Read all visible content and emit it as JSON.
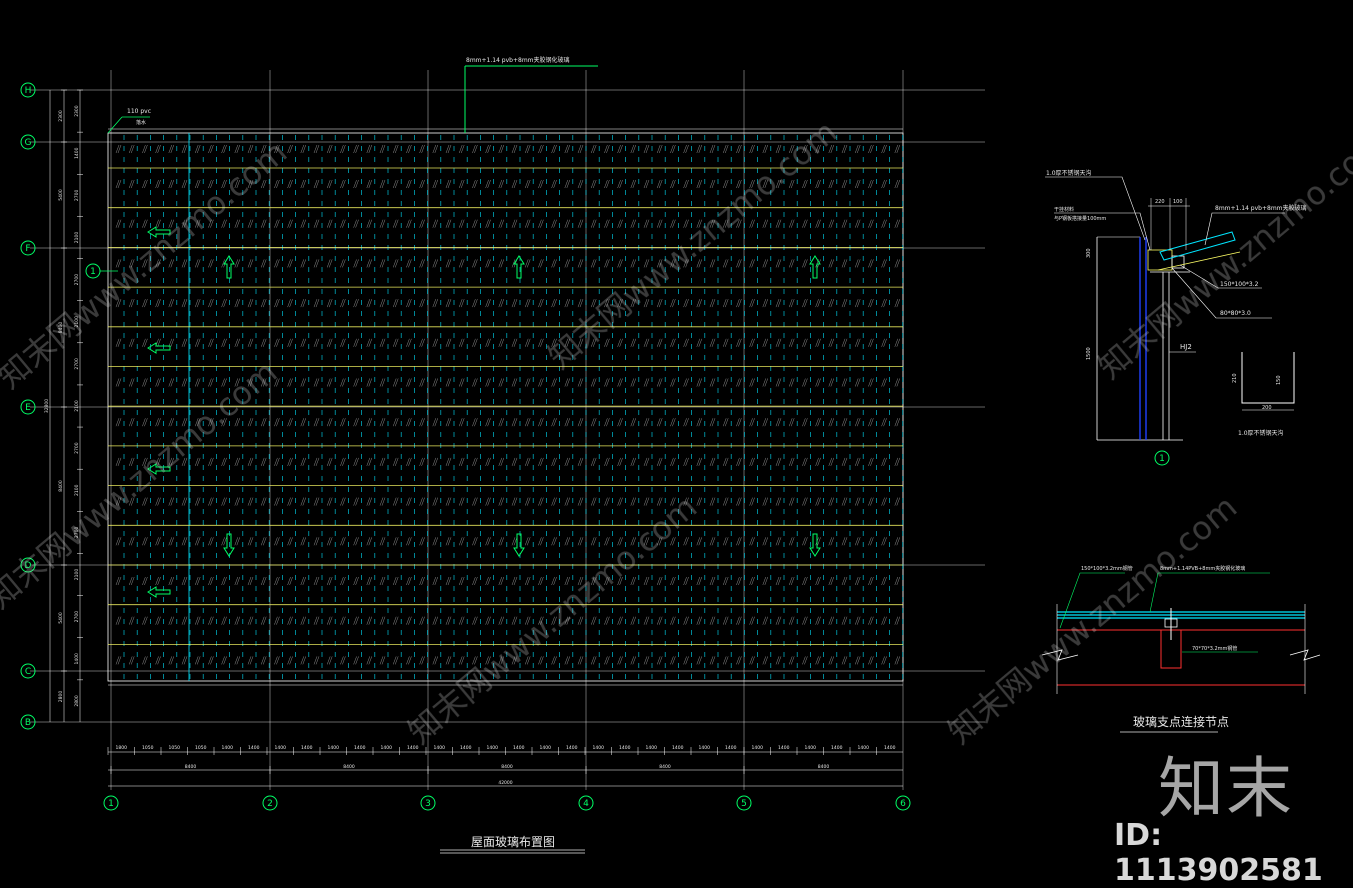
{
  "plan": {
    "title": "屋面玻璃布置图",
    "top_callout": "8mm+1.14 pvb+8mm夹胶钢化玻璃",
    "pvc_note": "110 pvc",
    "pvc_note2": "落水",
    "col_axes": [
      "1",
      "2",
      "3",
      "4",
      "5",
      "6"
    ],
    "row_axes": [
      "H",
      "G",
      "F",
      "E",
      "D",
      "C",
      "B"
    ],
    "dims_bottom_small": [
      "1800",
      "1050",
      "1050",
      "1050",
      "1400",
      "1400",
      "1400",
      "1400",
      "1400",
      "1400",
      "1400",
      "1400",
      "1400",
      "1400",
      "1400",
      "1400",
      "1400",
      "1400",
      "1400",
      "1400",
      "1400",
      "1400",
      "1400",
      "1400",
      "1400",
      "1400",
      "1400",
      "1400",
      "1400",
      "1400"
    ],
    "dims_bottom_bays": [
      "8400",
      "8400",
      "8400",
      "8400",
      "8400"
    ],
    "dim_bottom_total": "42000",
    "dims_left_small": [
      "2300",
      "1400",
      "2700",
      "2100",
      "2700",
      "2100",
      "2700",
      "2100",
      "2700",
      "2100",
      "2700",
      "2100",
      "2700",
      "1400",
      "2800"
    ],
    "dims_left_bays": [
      "2300",
      "5400",
      "8400",
      "8400",
      "5400",
      "2800"
    ],
    "dim_left_total": "32800"
  },
  "detail1": {
    "label_top": "1.0厚不锈钢天沟",
    "label_glass": "8mm+1.14 pvb+8mm夹胶玻璃",
    "label_gasket": "干挂材料",
    "label_gasket2": "与P钢板搭接量100mm",
    "label_a": "150*100*3.2",
    "label_b": "80*80*3.0",
    "label_hj": "HJ2",
    "dim_220": "220",
    "dim_100": "100",
    "dim_300": "300",
    "dim_1500": "1500",
    "gutter_w": "200",
    "gutter_h1": "210",
    "gutter_h2": "150",
    "gutter_label": "1.0厚不锈钢天沟",
    "bubble": "1"
  },
  "detail2": {
    "title": "玻璃支点连接节点",
    "label_left": "150*100*3.2mm钢管",
    "label_top": "8mm+1.14PVB+8mm夹胶钢化玻璃",
    "label_right": "70*70*3.2mm钢管"
  },
  "watermark": {
    "brand": "知末",
    "id": "ID: 1113902581",
    "diag": "知末网www.znzmo.com"
  },
  "colors": {
    "grid": "#ffffff",
    "purlin": "#ffff66",
    "glass": "#00e5ff",
    "bubble": "#00ff66",
    "arrow": "#00ff66",
    "steel": "#ff3030",
    "wall": "#2040ff"
  }
}
